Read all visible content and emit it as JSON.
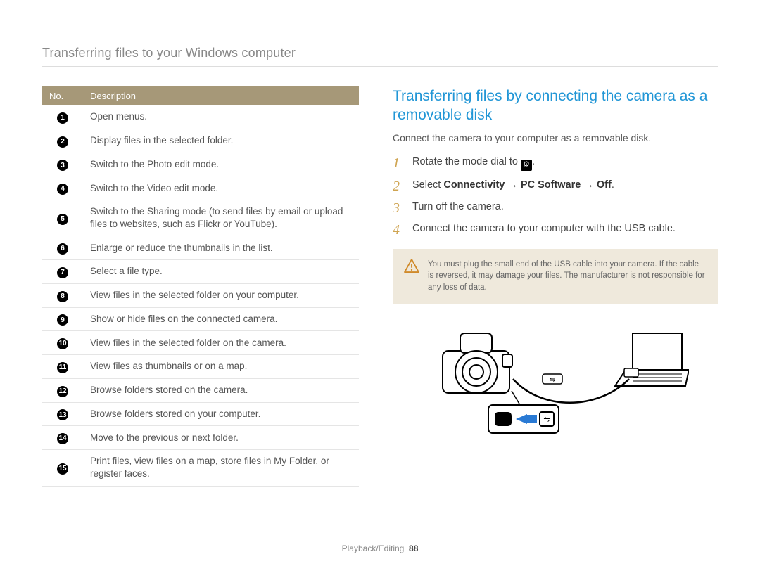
{
  "header": {
    "title": "Transferring files to your Windows computer"
  },
  "table": {
    "col_no": "No.",
    "col_desc": "Description",
    "rows": [
      {
        "n": "1",
        "d": "Open menus."
      },
      {
        "n": "2",
        "d": "Display files in the selected folder."
      },
      {
        "n": "3",
        "d": "Switch to the Photo edit mode."
      },
      {
        "n": "4",
        "d": "Switch to the Video edit mode."
      },
      {
        "n": "5",
        "d": "Switch to the Sharing mode (to send files by email or upload files to websites, such as Flickr or YouTube)."
      },
      {
        "n": "6",
        "d": "Enlarge or reduce the thumbnails in the list."
      },
      {
        "n": "7",
        "d": "Select a file type."
      },
      {
        "n": "8",
        "d": "View files in the selected folder on your computer."
      },
      {
        "n": "9",
        "d": "Show or hide files on the connected camera."
      },
      {
        "n": "10",
        "d": "View files in the selected folder on the camera."
      },
      {
        "n": "11",
        "d": "View files as thumbnails or on a map."
      },
      {
        "n": "12",
        "d": "Browse folders stored on the camera."
      },
      {
        "n": "13",
        "d": "Browse folders stored on your computer."
      },
      {
        "n": "14",
        "d": "Move to the previous or next folder."
      },
      {
        "n": "15",
        "d": "Print files, view files on a map, store files in My Folder, or register faces."
      }
    ]
  },
  "right": {
    "title": "Transferring files by connecting the camera as a removable disk",
    "intro": "Connect the camera to your computer as a removable disk.",
    "steps": {
      "s1_pre": "Rotate the mode dial to ",
      "s1_post": ".",
      "s2_pre": "Select ",
      "s2_b1": "Connectivity",
      "s2_arr": " → ",
      "s2_b2": "PC Software",
      "s2_b3": "Off",
      "s2_post": ".",
      "s3": "Turn off the camera.",
      "s4": "Connect the camera to your computer with the USB cable."
    },
    "nums": {
      "n1": "1",
      "n2": "2",
      "n3": "3",
      "n4": "4"
    },
    "warn": "You must plug the small end of the USB cable into your camera. If the cable is reversed, it may damage your files. The manufacturer is not responsible for any loss of data."
  },
  "footer": {
    "section": "Playback/Editing",
    "page": "88"
  }
}
